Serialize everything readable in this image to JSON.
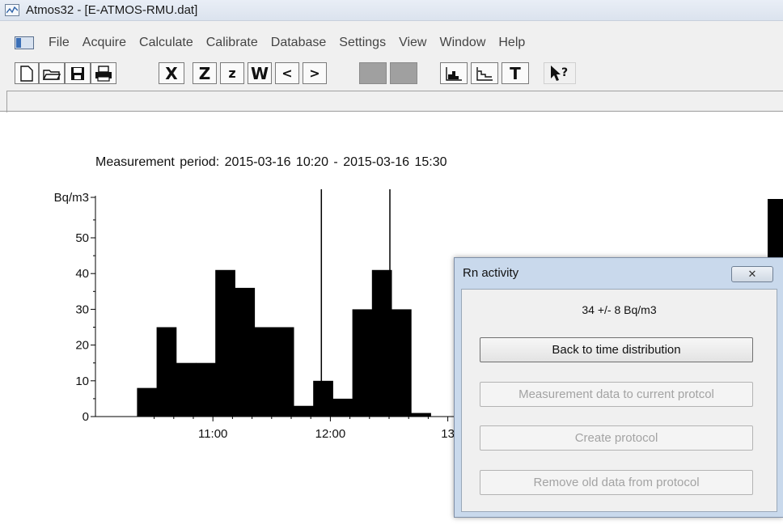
{
  "window": {
    "title": "Atmos32 - [E-ATMOS-RMU.dat]",
    "icon": "chart-app-icon"
  },
  "menu": {
    "items": [
      "File",
      "Acquire",
      "Calculate",
      "Calibrate",
      "Database",
      "Settings",
      "View",
      "Window",
      "Help"
    ]
  },
  "toolbar": {
    "buttons": [
      {
        "name": "new-document-icon",
        "glyph": "🗋"
      },
      {
        "name": "open-folder-icon",
        "glyph": "📂"
      },
      {
        "name": "save-disk-icon",
        "glyph": "💾"
      },
      {
        "name": "print-icon",
        "glyph": "🖶"
      },
      {
        "name": "x-button",
        "glyph": "X"
      },
      {
        "name": "z-upper-button",
        "glyph": "Z"
      },
      {
        "name": "z-lower-button",
        "glyph": "z"
      },
      {
        "name": "w-button",
        "glyph": "W"
      },
      {
        "name": "prev-button",
        "glyph": "<"
      },
      {
        "name": "next-button",
        "glyph": ">"
      },
      {
        "name": "disabled-button-1",
        "glyph": ""
      },
      {
        "name": "disabled-button-2",
        "glyph": ""
      },
      {
        "name": "histogram-icon",
        "glyph": ""
      },
      {
        "name": "step-line-icon",
        "glyph": ""
      },
      {
        "name": "text-button",
        "glyph": "T"
      },
      {
        "name": "help-pointer-icon",
        "glyph": "↖?"
      }
    ]
  },
  "plot": {
    "period_label": "Measurement period:",
    "period_start": "2015-03-16  10:20",
    "period_sep": "-",
    "period_end": "2015-03-16  15:30"
  },
  "chart_data": {
    "type": "bar",
    "title": "",
    "ylabel": "Bq/m3",
    "xlabel": "",
    "ylim": [
      0,
      60
    ],
    "y_ticks": [
      0,
      10,
      20,
      30,
      40,
      50
    ],
    "x_tick_labels": [
      "11:00",
      "12:00",
      "13"
    ],
    "x_tick_values_min": [
      60,
      120,
      180
    ],
    "x_start_min": 0,
    "bin_width_min": 10,
    "bins_start_min": 20,
    "values": [
      8,
      25,
      15,
      15,
      41,
      36,
      25,
      25,
      3,
      10,
      5,
      30,
      41,
      30,
      1
    ],
    "markers_min": [
      115,
      150
    ],
    "grid": false
  },
  "dialog": {
    "title": "Rn activity",
    "close_glyph": "✕",
    "value": "34 +/- 8 Bq/m3",
    "buttons": [
      {
        "label": "Back to time distribution",
        "enabled": true
      },
      {
        "label": "Measurement data to current protcol",
        "enabled": false
      },
      {
        "label": "Create protocol",
        "enabled": false
      },
      {
        "label": "Remove old data from protocol",
        "enabled": false
      }
    ]
  }
}
